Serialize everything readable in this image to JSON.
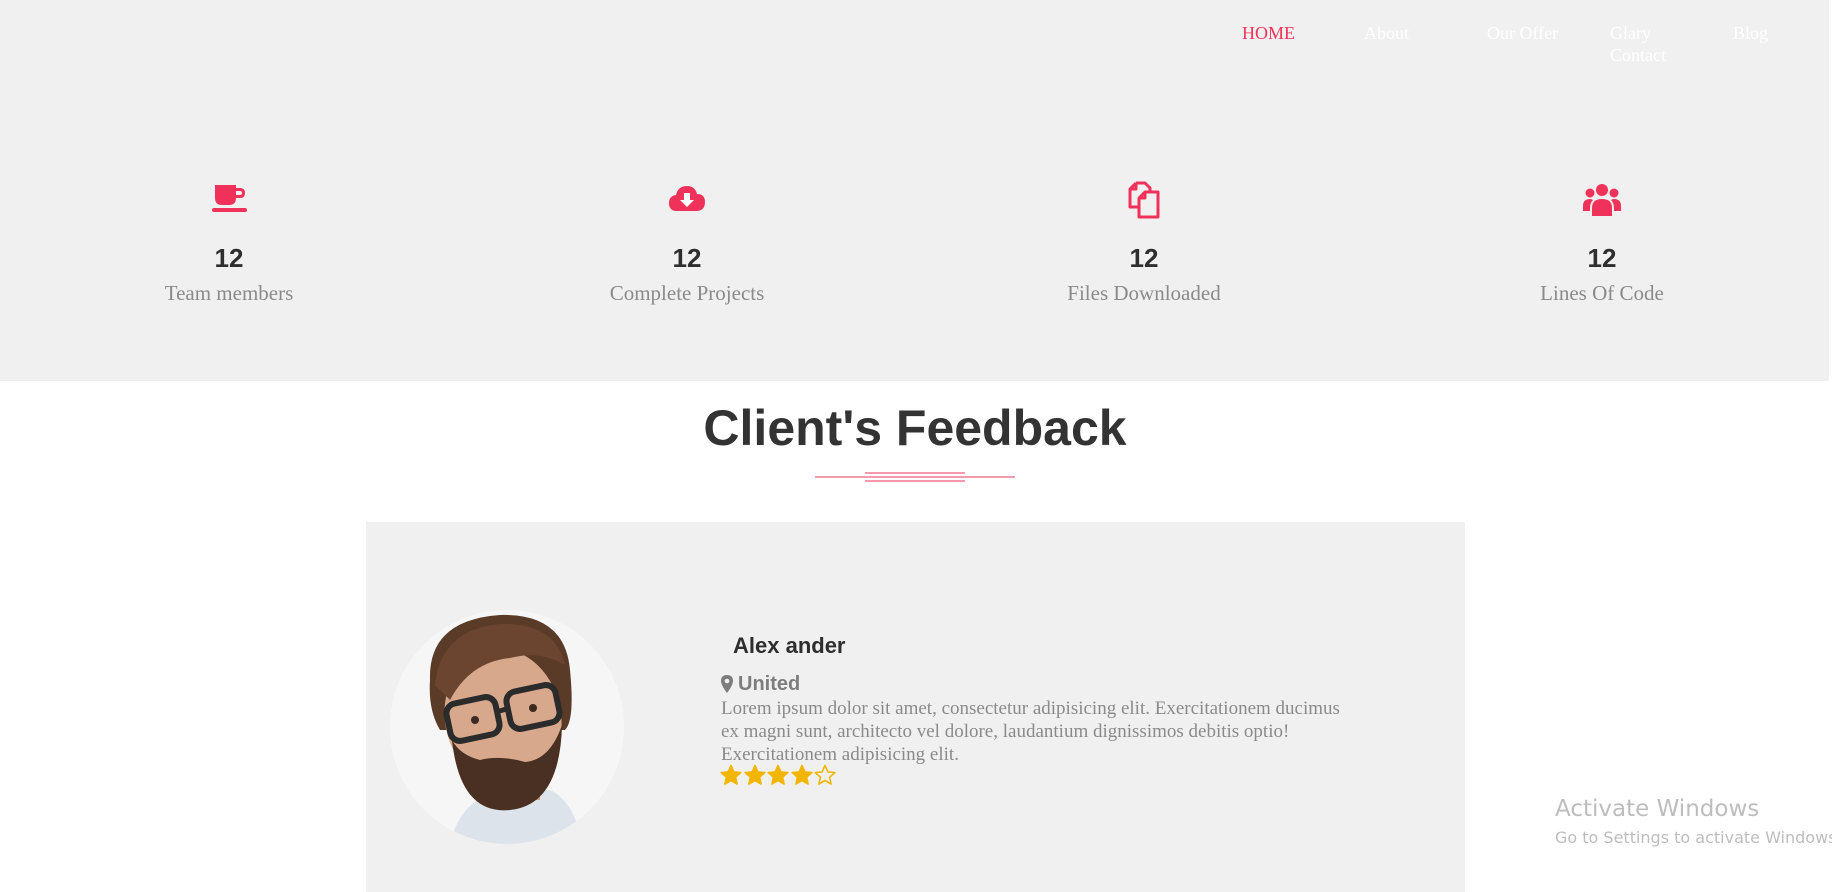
{
  "nav": {
    "items": [
      {
        "label": "HOME",
        "active": true
      },
      {
        "label": "About",
        "active": false
      },
      {
        "label": "Our Offer",
        "active": false
      },
      {
        "label": "Glary Contact",
        "active": false
      },
      {
        "label": "Blog",
        "active": false
      }
    ]
  },
  "stats": [
    {
      "icon": "coffee-cup-icon",
      "number": "12",
      "label": "Team members"
    },
    {
      "icon": "cloud-download-icon",
      "number": "12",
      "label": "Complete Projects"
    },
    {
      "icon": "files-icon",
      "number": "12",
      "label": "Files Downloaded"
    },
    {
      "icon": "users-icon",
      "number": "12",
      "label": "Lines Of Code"
    }
  ],
  "feedback": {
    "title": "Client's Feedback",
    "client": {
      "name": "Alex ander",
      "location": "United",
      "text": "Lorem ipsum dolor sit amet, consectetur adipisicing elit. Exercitationem ducimus ex magni sunt, architecto vel dolore, laudantium dignissimos debitis optio! Exercitationem adipisicing elit.",
      "rating": 4,
      "rating_max": 5
    }
  },
  "watermark": {
    "title": "Activate Windows",
    "subtitle": "Go to Settings to activate Windows."
  },
  "colors": {
    "accent": "#f0325a",
    "star": "#f2b600",
    "band_bg": "#f1f0f0",
    "heading": "#333333",
    "muted": "#8a8a8a"
  }
}
